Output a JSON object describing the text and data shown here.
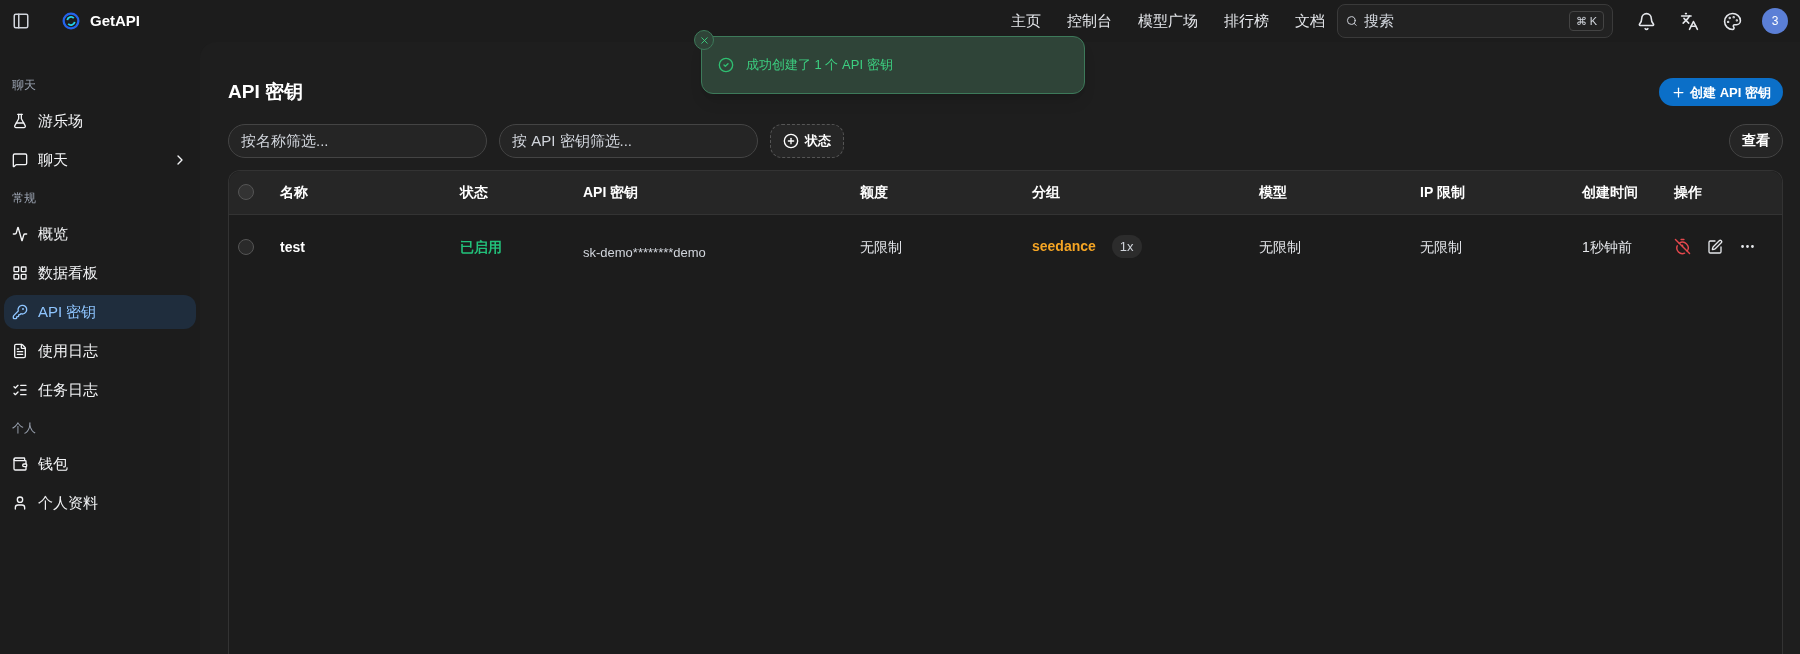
{
  "header": {
    "brand": "GetAPI",
    "nav": [
      "主页",
      "控制台",
      "模型广场",
      "排行榜",
      "文档"
    ],
    "search": {
      "placeholder": "搜索",
      "shortcut": "⌘ K"
    },
    "avatar": "3"
  },
  "toast": {
    "message": "成功创建了 1 个 API 密钥"
  },
  "sidebar": {
    "sections": [
      {
        "title": "聊天",
        "items": [
          {
            "label": "游乐场",
            "selected": false,
            "expandable": false
          },
          {
            "label": "聊天",
            "selected": false,
            "expandable": true
          }
        ]
      },
      {
        "title": "常规",
        "items": [
          {
            "label": "概览",
            "selected": false,
            "expandable": false
          },
          {
            "label": "数据看板",
            "selected": false,
            "expandable": false
          },
          {
            "label": "API 密钥",
            "selected": true,
            "expandable": false
          },
          {
            "label": "使用日志",
            "selected": false,
            "expandable": false
          },
          {
            "label": "任务日志",
            "selected": false,
            "expandable": false
          }
        ]
      },
      {
        "title": "个人",
        "items": [
          {
            "label": "钱包",
            "selected": false,
            "expandable": false
          },
          {
            "label": "个人资料",
            "selected": false,
            "expandable": false
          }
        ]
      }
    ]
  },
  "page": {
    "title": "API 密钥",
    "create_button": "创建 API 密钥",
    "filters": [
      {
        "placeholder": "按名称筛选..."
      },
      {
        "placeholder": "按 API 密钥筛选..."
      }
    ],
    "status_filter": "状态",
    "view_button": "查看"
  },
  "table": {
    "all_selected": false,
    "columns": [
      "名称",
      "状态",
      "API 密钥",
      "额度",
      "分组",
      "模型",
      "IP 限制",
      "创建时间",
      "操作"
    ],
    "rows": [
      {
        "selected": false,
        "name": "test",
        "status": "已启用",
        "key": "sk-demo********demo",
        "quota": "无限制",
        "group": "seedance",
        "ratio": "1x",
        "model": "无限制",
        "ip": "无限制",
        "created": "1秒钟前"
      }
    ]
  }
}
